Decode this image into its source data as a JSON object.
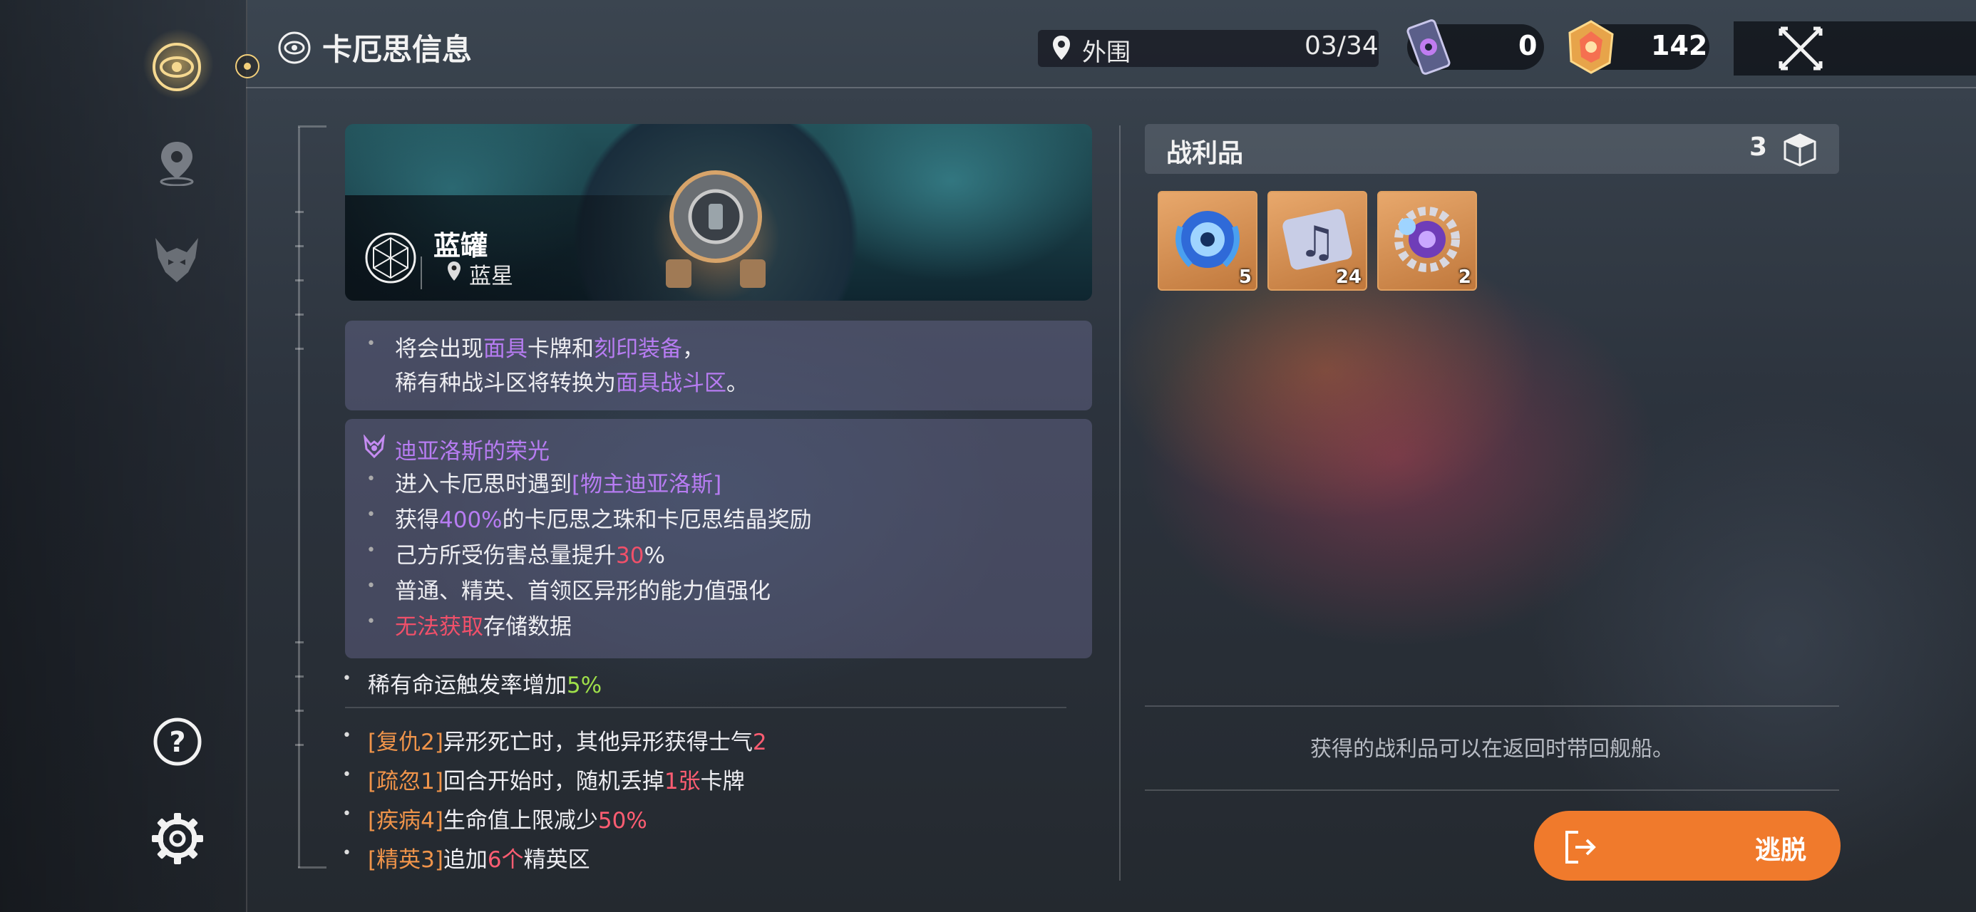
{
  "header": {
    "title": "卡厄思信息",
    "location": "外围",
    "location_progress": "03/34",
    "currency_1": "0",
    "currency_2": "142"
  },
  "sidebar": {
    "items": [
      "chaos-icon",
      "map-pin-icon",
      "demon-mask-icon"
    ],
    "help": "?",
    "settings": "gear"
  },
  "banner": {
    "name": "蓝罐",
    "planet": "蓝星"
  },
  "card_top": {
    "line1": [
      "将会出现",
      "面具",
      "卡牌和",
      "刻印装备",
      "，"
    ],
    "line2": [
      "稀有种战斗区将转换为",
      "面具战斗区",
      "。"
    ]
  },
  "card_glory": {
    "title": "迪亚洛斯的荣光",
    "l1": [
      "进入卡厄思时遇到",
      "[物主迪亚洛斯]"
    ],
    "l2": [
      "获得",
      "400%",
      "的卡厄思之珠和卡厄思结晶奖励"
    ],
    "l3": [
      "己方所受伤害总量提升",
      "30",
      "%"
    ],
    "l4": "普通、精英、首领区异形的能力值强化",
    "l5": [
      "无法获取",
      "存储数据"
    ]
  },
  "modifiers": {
    "rare": [
      "稀有命运触发率增加",
      "5%"
    ],
    "m1": [
      "[复仇2]",
      "异形死亡时，其他异形获得士气",
      "2"
    ],
    "m2": [
      "[疏忽1]",
      "回合开始时，随机丢掉",
      "1张",
      "卡牌"
    ],
    "m3": [
      "[疾病4]",
      "生命值上限减少",
      "50%"
    ],
    "m4": [
      "[精英3]",
      "追加",
      "6个",
      "精英区"
    ]
  },
  "loot": {
    "title": "战利品",
    "count": "3",
    "items": [
      {
        "icon": "blue-orb-item-icon",
        "qty": "5"
      },
      {
        "icon": "music-scroll-item-icon",
        "qty": "24"
      },
      {
        "icon": "gear-crystal-item-icon",
        "qty": "2"
      }
    ],
    "note": "获得的战利品可以在返回时带回舰船。"
  },
  "escape_label": "逃脱",
  "colors": {
    "accent_orange": "#f07a2c",
    "purple": "#b77cf2",
    "red": "#f0506a",
    "green": "#9fe04a"
  }
}
